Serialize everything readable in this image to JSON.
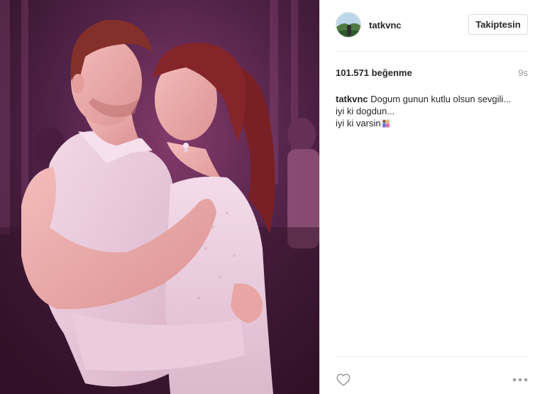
{
  "post": {
    "image_alt": "Couple dancing embrace photo",
    "author": {
      "username": "tatkvnc"
    },
    "follow_button": {
      "label": "Takiptesin"
    },
    "likes_text": "101.571 beğenme",
    "time_ago": "9s",
    "caption": {
      "username": "tatkvnc",
      "line1": "Dogum gunun kutlu olsun sevgili...",
      "line2": "iyi ki dogdun...",
      "line3": "iyi ki varsin"
    },
    "actions": {
      "like_icon": "heart-outline-icon",
      "more_icon": "more-options-icon"
    }
  }
}
